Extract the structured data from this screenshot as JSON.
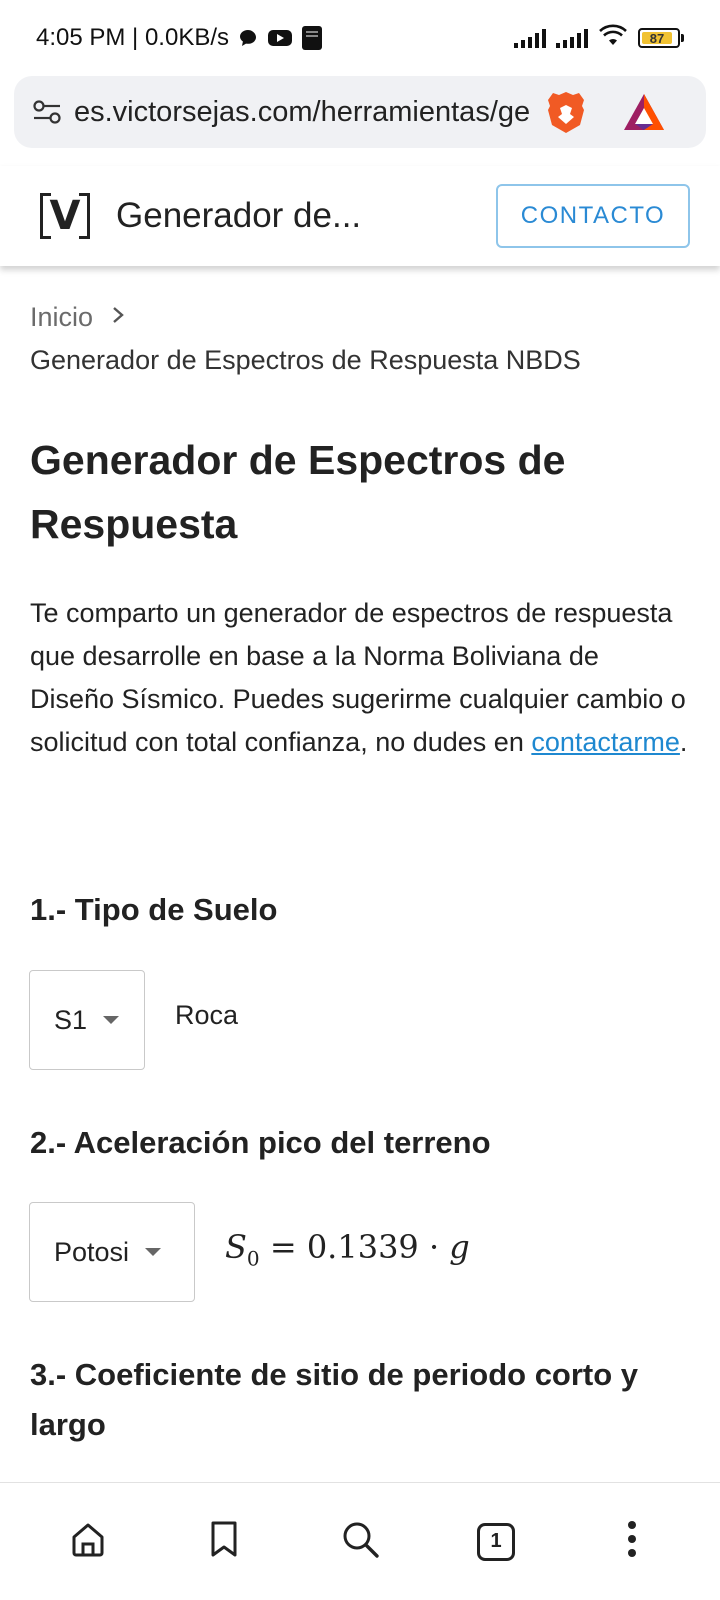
{
  "status_bar": {
    "time_speed": "4:05 PM | 0.0KB/s",
    "battery": "87"
  },
  "browser": {
    "url": "es.victorsejas.com/herramientas/generador"
  },
  "header": {
    "logo": "V",
    "site_title": "Generador de...",
    "contact_label": "CONTACTO"
  },
  "breadcrumb": {
    "home": "Inicio",
    "current": "Generador de Espectros de Respuesta NBDS"
  },
  "page": {
    "title": "Generador de Espectros de Respuesta",
    "intro_text": "Te comparto un generador de espectros de respuesta que desarrolle en base a la Norma Boliviana de Diseño Sísmico. Puedes sugerirme cualquier cambio o solicitud con total confianza, no dudes en ",
    "intro_link": "contactarme",
    "intro_end": "."
  },
  "sections": {
    "s1_title": "1.- Tipo de Suelo",
    "s1_select": "S1",
    "s1_label": "Roca",
    "s2_title": "2.- Aceleración pico del terreno",
    "s2_select": "Potosi",
    "s2_formula_var": "S",
    "s2_formula_sub": "0",
    "s2_formula_rest": " = 0.1339 · ",
    "s2_formula_g": "g",
    "s3_title": "3.- Coeficiente de sitio de periodo corto y largo"
  },
  "bottom_nav": {
    "tab_count": "1"
  }
}
